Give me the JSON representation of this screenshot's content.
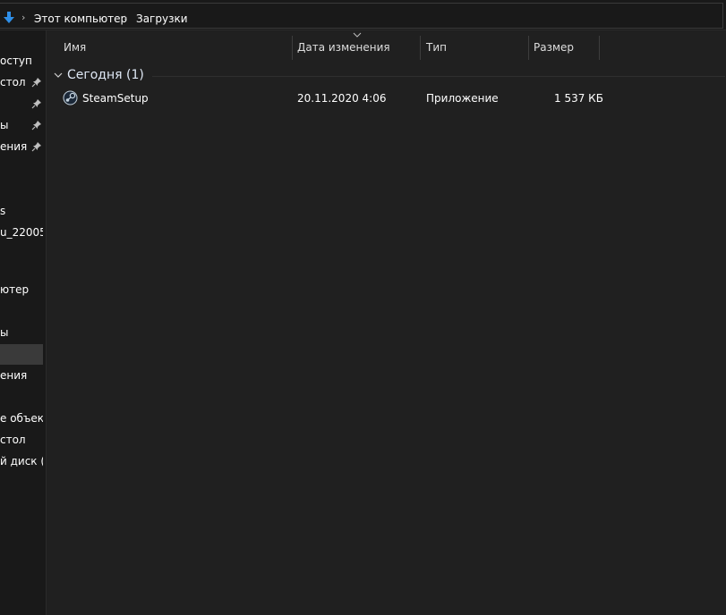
{
  "address": {
    "crumbs": [
      "Этот компьютер",
      "Загрузки"
    ]
  },
  "nav": {
    "items": [
      {
        "label": "оступ",
        "pinned": false,
        "selected": false
      },
      {
        "label": "стол",
        "pinned": true,
        "selected": false
      },
      {
        "label": "",
        "pinned": true,
        "selected": false
      },
      {
        "label": "ы",
        "pinned": true,
        "selected": false
      },
      {
        "label": "ения",
        "pinned": true,
        "selected": false
      },
      {
        "label": "s",
        "pinned": false,
        "selected": false
      },
      {
        "label": "u_22005",
        "pinned": false,
        "selected": false
      },
      {
        "label": "ютер",
        "pinned": false,
        "selected": false
      },
      {
        "label": "ы",
        "pinned": false,
        "selected": false
      },
      {
        "label": "",
        "pinned": false,
        "selected": true
      },
      {
        "label": "ения",
        "pinned": false,
        "selected": false
      },
      {
        "label": "е объекты",
        "pinned": false,
        "selected": false
      },
      {
        "label": "стол",
        "pinned": false,
        "selected": false
      },
      {
        "label": "й диск (С",
        "pinned": false,
        "selected": false
      }
    ]
  },
  "columns": {
    "name": "Имя",
    "date": "Дата изменения",
    "type": "Тип",
    "size": "Размер"
  },
  "group": {
    "label": "Сегодня (1)"
  },
  "files": [
    {
      "name": "SteamSetup",
      "date": "20.11.2020 4:06",
      "type": "Приложение",
      "size": "1 537 КБ",
      "icon": "steam-icon"
    }
  ],
  "colors": {
    "background": "#191919",
    "content": "#202020",
    "accent": "#2f8fe8",
    "selected": "#3a3a3a"
  }
}
